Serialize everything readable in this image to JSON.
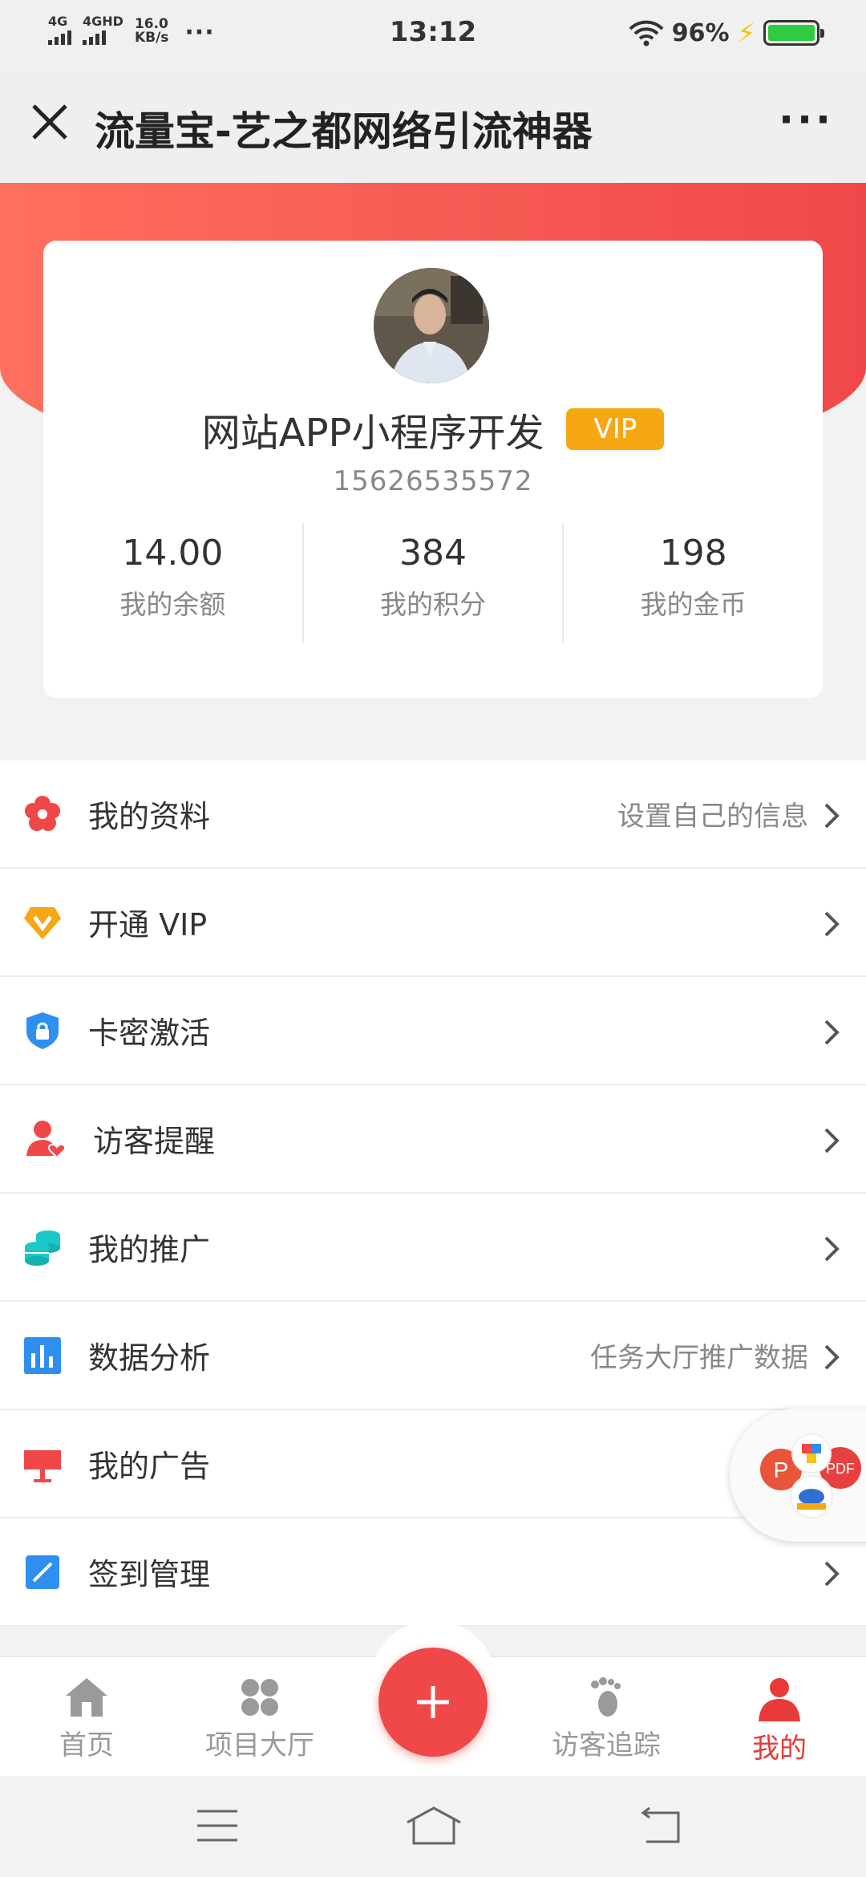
{
  "status_bar": {
    "net1": "4G",
    "net2": "4GHD",
    "speed_value": "16.0",
    "speed_unit": "KB/s",
    "more_dots": "···",
    "time": "13:12",
    "battery_percent": "96%"
  },
  "titlebar": {
    "title": "流量宝-艺之都网络引流神器",
    "more_label": "···"
  },
  "profile": {
    "name": "网站APP小程序开发",
    "badge": "VIP",
    "phone": "15626535572",
    "stats": [
      {
        "value": "14.00",
        "label": "我的余额"
      },
      {
        "value": "384",
        "label": "我的积分"
      },
      {
        "value": "198",
        "label": "我的金币"
      }
    ]
  },
  "menu": [
    {
      "label": "我的资料",
      "hint": "设置自己的信息",
      "icon": "profile-flower-icon",
      "color": "#f04848"
    },
    {
      "label": "开通 VIP",
      "hint": "",
      "icon": "vip-diamond-icon",
      "color": "#f7a614"
    },
    {
      "label": "卡密激活",
      "hint": "",
      "icon": "shield-lock-icon",
      "color": "#2f8ff0"
    },
    {
      "label": "访客提醒",
      "hint": "",
      "icon": "user-heart-icon",
      "color": "#f04848"
    },
    {
      "label": "我的推广",
      "hint": "",
      "icon": "coins-stack-icon",
      "color": "#1cc7c7"
    },
    {
      "label": "数据分析",
      "hint": "任务大厅推广数据",
      "icon": "bar-chart-icon",
      "color": "#2f8ff0"
    },
    {
      "label": "我的广告",
      "hint": "",
      "icon": "billboard-icon",
      "color": "#f04848"
    },
    {
      "label": "签到管理",
      "hint": "",
      "icon": "edit-square-icon",
      "color": "#2f8ff0"
    }
  ],
  "float_app": {
    "letter": "P",
    "pdf": "PDF"
  },
  "tabbar": {
    "tabs": [
      {
        "label": "首页",
        "icon": "home-icon"
      },
      {
        "label": "项目大厅",
        "icon": "clover-icon"
      },
      {
        "label": "访客追踪",
        "icon": "footprint-icon"
      },
      {
        "label": "我的",
        "icon": "person-icon"
      }
    ],
    "plus": "+"
  },
  "colors": {
    "accent": "#f04848",
    "vip": "#f7a614",
    "active_tab": "#e83a3a"
  }
}
